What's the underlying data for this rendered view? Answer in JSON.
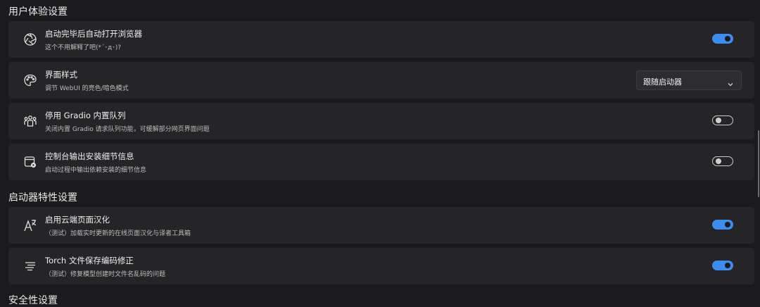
{
  "sections": [
    {
      "title": "用户体验设置",
      "items": [
        {
          "title": "启动完毕后自动打开浏览器",
          "desc": "这个不用解释了吧(*´･д･)?",
          "control": "toggle",
          "state": "on",
          "icon": "aperture-icon"
        },
        {
          "title": "界面样式",
          "desc": "调节 WebUI 的亮色/暗色模式",
          "control": "select",
          "value": "跟随启动器",
          "icon": "palette-icon"
        },
        {
          "title": "停用 Gradio 内置队列",
          "desc": "关闭内置 Gradio 请求队列功能，可缓解部分网页界面问题",
          "control": "toggle",
          "state": "off",
          "icon": "people-group-icon"
        },
        {
          "title": "控制台输出安装细节信息",
          "desc": "启动过程中输出依赖安装的细节信息",
          "control": "toggle",
          "state": "off",
          "icon": "window-play-icon"
        }
      ]
    },
    {
      "title": "启动器特性设置",
      "items": [
        {
          "title": "启用云端页面汉化",
          "desc": "（测试）加载实时更新的在线页面汉化与译者工具箱",
          "control": "toggle",
          "state": "on",
          "icon": "translate-icon"
        },
        {
          "title": "Torch 文件保存编码修正",
          "desc": "（测试）修复模型创建时文件名乱码的问题",
          "control": "toggle",
          "state": "on",
          "icon": "text-align-icon"
        }
      ]
    },
    {
      "title": "安全性设置"
    }
  ],
  "colors": {
    "accent": "#3b8df0",
    "card": "#252528",
    "background": "#1b1b1e"
  }
}
